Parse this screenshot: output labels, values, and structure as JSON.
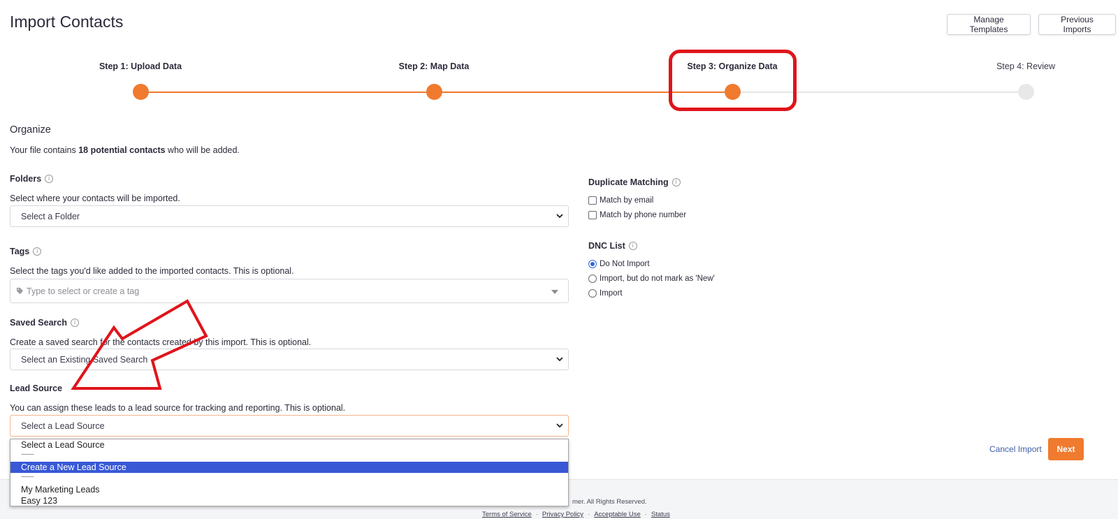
{
  "header": {
    "title": "Import Contacts",
    "manage_templates": "Manage Templates",
    "previous_imports": "Previous Imports"
  },
  "steps": [
    {
      "label": "Step 1: Upload Data",
      "status": "complete"
    },
    {
      "label": "Step 2: Map Data",
      "status": "complete"
    },
    {
      "label": "Step 3: Organize Data",
      "status": "current"
    },
    {
      "label": "Step 4: Review",
      "status": "upcoming"
    }
  ],
  "organize": {
    "heading": "Organize",
    "summary_prefix": "Your file contains ",
    "summary_bold": "18 potential contacts",
    "summary_suffix": " who will be added."
  },
  "folders": {
    "title": "Folders",
    "desc": "Select where your contacts will be imported.",
    "value": "Select a Folder"
  },
  "tags": {
    "title": "Tags",
    "desc": "Select the tags you'd like added to the imported contacts. This is optional.",
    "placeholder": "Type to select or create a tag"
  },
  "saved_search": {
    "title": "Saved Search",
    "desc": "Create a saved search for the contacts created by this import. This is optional.",
    "value": "Select an Existing Saved Search"
  },
  "lead_source": {
    "title": "Lead Source",
    "desc": "You can assign these leads to a lead source for tracking and reporting. This is optional.",
    "value": "Select a Lead Source",
    "options": [
      "Select a Lead Source",
      "---------",
      "Create a New Lead Source",
      "---------",
      "My Marketing Leads",
      "Easy 123"
    ],
    "highlighted_option": "Create a New Lead Source"
  },
  "duplicate_matching": {
    "title": "Duplicate Matching",
    "options": [
      "Match by email",
      "Match by phone number"
    ]
  },
  "dnc_list": {
    "title": "DNC List",
    "options": [
      "Do Not Import",
      "Import, but do not mark as 'New'",
      "Import"
    ],
    "selected": "Do Not Import"
  },
  "actions": {
    "cancel": "Cancel Import",
    "next": "Next"
  },
  "footer": {
    "copyright": "mer. All Rights Reserved.",
    "links": [
      "Terms of Service",
      "Privacy Policy",
      "Acceptable Use",
      "Status"
    ]
  },
  "colors": {
    "accent": "#f07a2e",
    "highlight_box": "#e0141c",
    "selected_option": "#3858d6",
    "link": "#3e5ea8"
  }
}
